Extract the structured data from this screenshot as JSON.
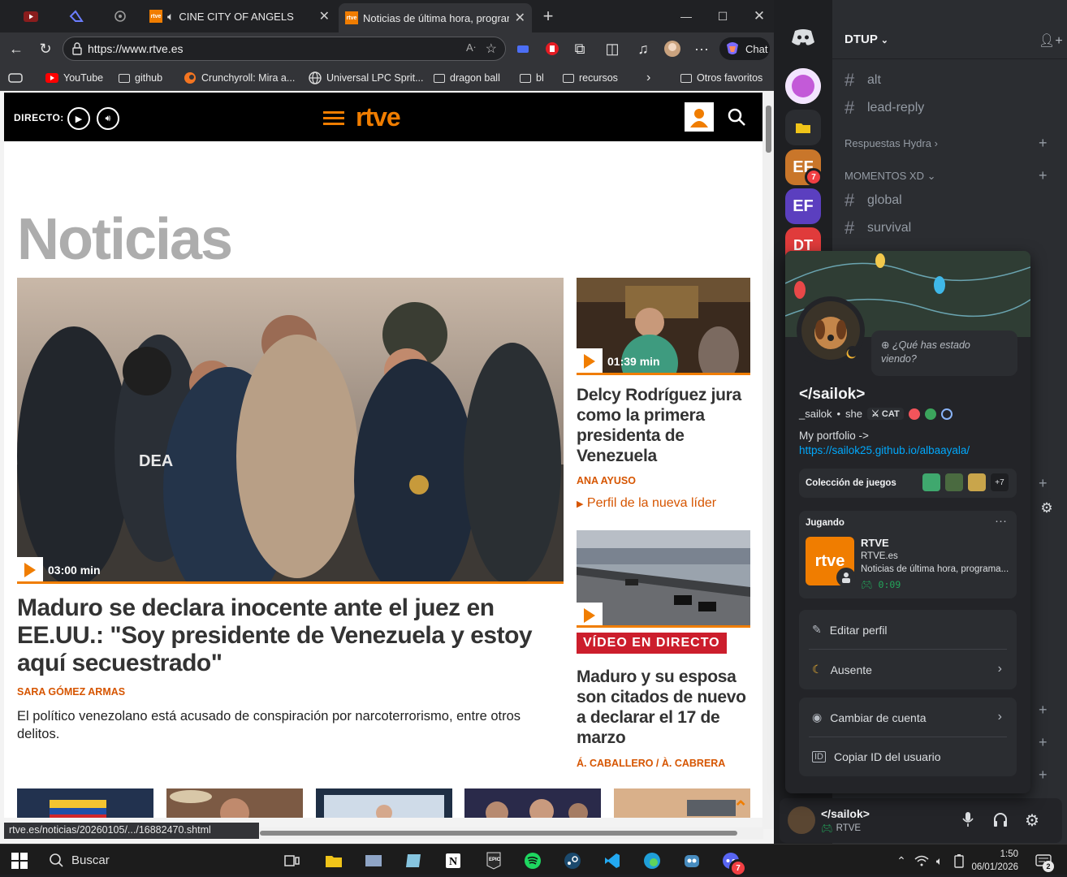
{
  "browser": {
    "tabs": [
      {
        "title": "CINE CITY OF ANGELS"
      },
      {
        "title": "Noticias de última hora, programa"
      }
    ],
    "address": "https://www.rtve.es",
    "chat_label": "Chat",
    "bookmarks": [
      "YouTube",
      "github",
      "Crunchyroll: Mira a...",
      "Universal LPC Sprit...",
      "dragon ball",
      "bl",
      "recursos"
    ],
    "other_favorites": "Otros favoritos",
    "status_url": "rtve.es/noticias/20260105/.../16882470.shtml"
  },
  "rtve": {
    "directo_label": "DIRECTO:",
    "logo_text": "rtve",
    "section_heading": "Noticias",
    "main": {
      "duration": "03:00 min",
      "title": "Maduro se declara inocente ante el juez en EE.UU.: \"Soy presidente de Venezuela y estoy aquí secuestrado\"",
      "author": "SARA GÓMEZ ARMAS",
      "description": "El político venezolano está acusado de conspiración por narcoterrorismo, entre otros delitos."
    },
    "side1": {
      "duration": "01:39 min",
      "title": "Delcy Rodríguez jura como la primera presidenta de Venezuela",
      "author": "ANA AYUSO",
      "link": "Perfil de la nueva líder"
    },
    "side2": {
      "badge": "VÍDEO EN DIRECTO",
      "title": "Maduro y su esposa son citados de nuevo a declarar el 17 de marzo",
      "author": "Á. CABALLERO / À. CABRERA"
    }
  },
  "discord": {
    "server_name": "DTUP",
    "guild_badge": "7",
    "channels_top": [
      "alt",
      "lead-reply"
    ],
    "category1": "Respuestas Hydra",
    "category2": "MOMENTOS XD",
    "channels_mid": [
      "global",
      "survival"
    ],
    "profile": {
      "status_prompt": "¿Qué has estado viendo?",
      "display_name": "</sailok>",
      "username": "_sailok",
      "pronouns": "she",
      "tag": "CAT",
      "bio_line": "My portfolio ->",
      "bio_link": "https://sailok25.github.io/albaayala/",
      "games_label": "Colección de juegos",
      "games_more": "+7",
      "playing_label": "Jugando",
      "activity_name": "RTVE",
      "activity_logo": "rtve",
      "activity_site": "RTVE.es",
      "activity_detail": "Noticias de última hora, programa...",
      "activity_time": "0:09",
      "menu": [
        "Editar perfil",
        "Ausente",
        "Cambiar de cuenta",
        "Copiar ID del usuario"
      ]
    },
    "panel": {
      "name": "</sailok>",
      "activity": "RTVE"
    }
  },
  "taskbar": {
    "search_placeholder": "Buscar",
    "time": "1:50",
    "date": "06/01/2026",
    "notification_count": "2",
    "discord_badge": "7"
  },
  "colors": {
    "rtve_orange": "#f07d00",
    "discord_bg": "#2b2d31",
    "live_red": "#cc1e2c"
  }
}
